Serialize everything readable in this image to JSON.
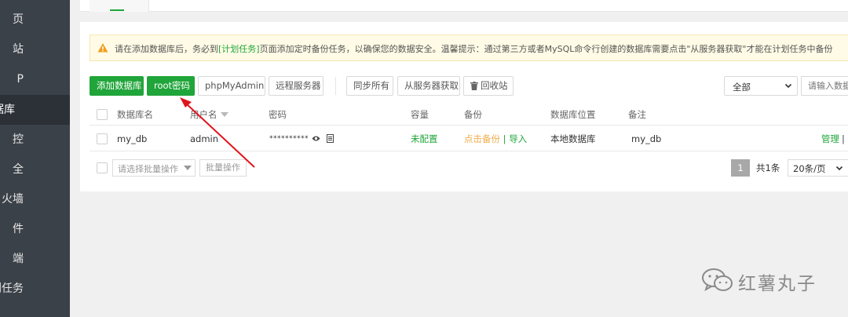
{
  "sidebar": {
    "items": [
      {
        "label": "页"
      },
      {
        "label": "站"
      },
      {
        "label": "P"
      },
      {
        "label": "据库",
        "active": true
      },
      {
        "label": "控"
      },
      {
        "label": "全"
      },
      {
        "label": "火墙"
      },
      {
        "label": "件"
      },
      {
        "label": "端"
      },
      {
        "label": "划任务"
      }
    ]
  },
  "notice": {
    "prefix": "请在添加数据库后，务必到",
    "link": "[计划任务]",
    "suffix": "页面添加定时备份任务，以确保您的数据安全。温馨提示：通过第三方或者MySQL命令行创建的数据库需要点击\"从服务器获取\"才能在计划任务中备份"
  },
  "toolbar": {
    "add_db": "添加数据库",
    "root_pwd": "root密码",
    "phpmyadmin": "phpMyAdmin",
    "remote_server": "远程服务器",
    "sync_all": "同步所有",
    "get_from_server": "从服务器获取",
    "recycle_bin": "回收站",
    "filter_value": "全部",
    "search_placeholder": "请输入数据"
  },
  "table": {
    "headers": {
      "name": "数据库名",
      "user": "用户名",
      "password": "密码",
      "capacity": "容量",
      "backup": "备份",
      "location": "数据库位置",
      "remark": "备注"
    },
    "rows": [
      {
        "name": "my_db",
        "user": "admin",
        "password": "**********",
        "capacity": "未配置",
        "backup_action": "点击备份",
        "sep": "|",
        "import_action": "导入",
        "location": "本地数据库",
        "remark": "my_db",
        "manage": "管理",
        "manage_sep": "|"
      }
    ]
  },
  "footer": {
    "batch_placeholder": "请选择批量操作",
    "batch_button": "批量操作",
    "current_page": "1",
    "total": "共1条",
    "page_size": "20条/页"
  },
  "watermark": {
    "text": "红薯丸子"
  },
  "colors": {
    "accent": "#20a53a",
    "sidebar_bg": "#3b4149",
    "annotation": "#e0141e",
    "backup_link": "#f0ad4e"
  }
}
